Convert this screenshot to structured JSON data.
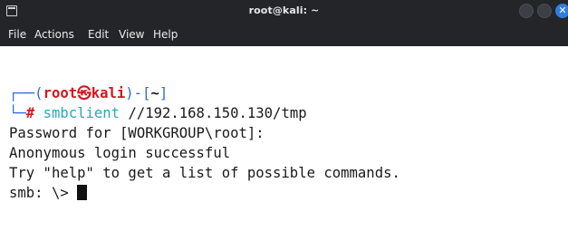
{
  "window": {
    "title": "root@kali: ~",
    "close_glyph": "✕"
  },
  "menu": {
    "items": [
      "File",
      "Actions",
      "Edit",
      "View",
      "Help"
    ]
  },
  "terminal": {
    "prompt": {
      "corner_top": "┌──(",
      "user": "root",
      "at_symbol": "㉿",
      "host": "kali",
      "mid": ")-[",
      "cwd": "~",
      "end": "]",
      "corner_bottom": "└─",
      "hash": "#",
      "command": "smbclient",
      "argument": " //192.168.150.130/tmp"
    },
    "output": [
      "Password for [WORKGROUP\\root]:",
      "Anonymous login successful",
      "Try \"help\" to get a list of possible commands."
    ],
    "smb_prompt": "smb: \\> "
  },
  "icons": {
    "app": "terminal-app-icon",
    "minimize": "minimize-button",
    "maximize": "maximize-button",
    "close": "close-icon"
  },
  "colors": {
    "titlebar": "#232529",
    "prompt_frame": "#2f6ad0",
    "prompt_user": "#d3171e",
    "command": "#2aa8b8",
    "close_button": "#2f7de1"
  }
}
